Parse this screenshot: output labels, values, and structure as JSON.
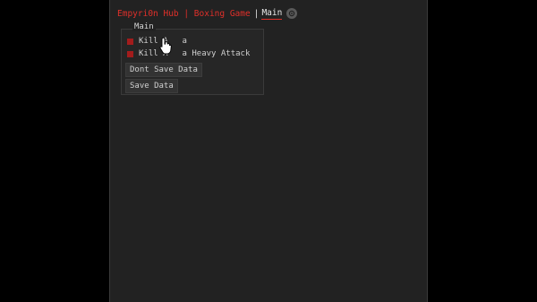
{
  "header": {
    "hub_title": "Empyri0n Hub | Boxing Game",
    "separator": "|",
    "tab_main": "Main",
    "settings_icon": "gear-icon"
  },
  "section": {
    "title": "Main",
    "toggles": [
      {
        "label_start": "Kill A",
        "label_end": "a",
        "enabled": true
      },
      {
        "label_start": "Kill A",
        "label_end": "a Heavy Attack",
        "enabled": true
      }
    ],
    "buttons": [
      {
        "label": "Dont Save Data"
      },
      {
        "label": "Save Data"
      }
    ]
  },
  "colors": {
    "accent": "#e0302a",
    "toggle_on": "#a31c1c",
    "window_bg": "#222222",
    "page_bg": "#000000"
  },
  "cursor_icon": "hand-pointer-icon"
}
